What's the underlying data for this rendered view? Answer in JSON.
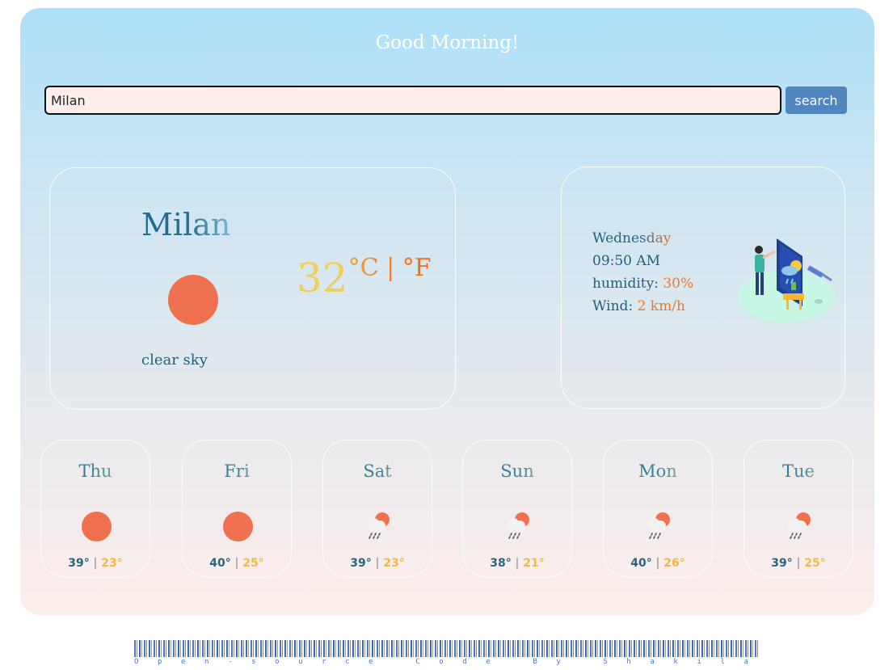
{
  "greeting": "Good Morning!",
  "search": {
    "value": "Milan",
    "button_label": "search"
  },
  "current": {
    "city": "Milan",
    "icon": "sun-icon",
    "description": "clear sky",
    "temperature": "32",
    "units": "°C | °F"
  },
  "details": {
    "day": "Wednesday",
    "time": "09:50 AM",
    "humidity_label": "humidity:",
    "humidity_value": "30%",
    "wind_label": "Wind:",
    "wind_value": "2 km/h"
  },
  "forecast": [
    {
      "day": "Thu",
      "icon": "sun-icon",
      "high": "39°",
      "low": "23°"
    },
    {
      "day": "Fri",
      "icon": "sun-icon",
      "high": "40°",
      "low": "25°"
    },
    {
      "day": "Sat",
      "icon": "rain-cloud-icon",
      "high": "39°",
      "low": "23°"
    },
    {
      "day": "Sun",
      "icon": "rain-cloud-icon",
      "high": "38°",
      "low": "21°"
    },
    {
      "day": "Mon",
      "icon": "rain-cloud-icon",
      "high": "40°",
      "low": "26°"
    },
    {
      "day": "Tue",
      "icon": "rain-cloud-icon",
      "high": "39°",
      "low": "25°"
    }
  ],
  "footer": {
    "text": "Open-source Code By Shakila"
  },
  "colors": {
    "accent": "#4f86bd",
    "sun": "#f07150",
    "temp": "#f0cf5e",
    "low_temp": "#f4b942"
  }
}
